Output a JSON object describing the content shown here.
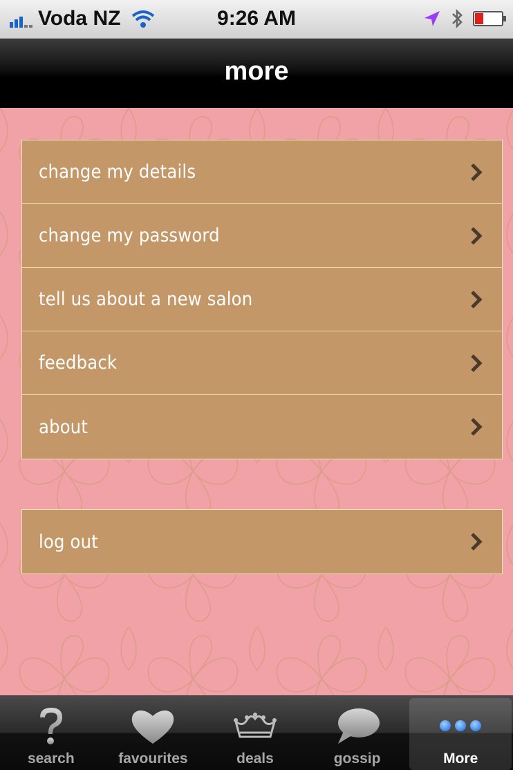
{
  "status_bar": {
    "carrier": "Voda NZ",
    "time": "9:26 AM"
  },
  "nav": {
    "title": "more"
  },
  "menu": {
    "items": [
      {
        "label": "change my details"
      },
      {
        "label": "change my password"
      },
      {
        "label": "tell us about a new salon"
      },
      {
        "label": "feedback"
      },
      {
        "label": "about"
      }
    ],
    "logout": {
      "label": "log out"
    }
  },
  "tabs": [
    {
      "label": "search",
      "icon": "question-mark-icon"
    },
    {
      "label": "favourites",
      "icon": "heart-icon"
    },
    {
      "label": "deals",
      "icon": "crown-icon"
    },
    {
      "label": "gossip",
      "icon": "speech-bubble-icon"
    },
    {
      "label": "More",
      "icon": "more-dots-icon",
      "selected": true
    }
  ],
  "colors": {
    "background_pink": "#f0a2a6",
    "row_tan": "#c39767",
    "row_border": "#f2dcae",
    "more_dots_blue": "#3d8bf0"
  }
}
